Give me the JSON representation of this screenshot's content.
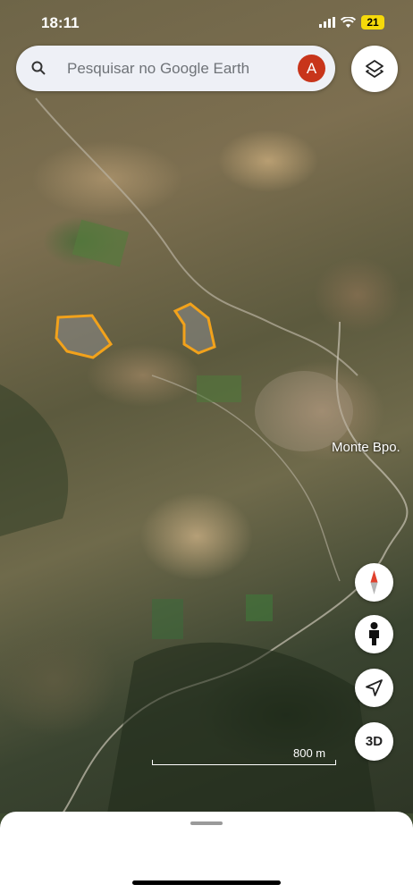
{
  "status_bar": {
    "time": "18:11",
    "battery": "21"
  },
  "search": {
    "placeholder": "Pesquisar no Google Earth"
  },
  "account": {
    "initial": "A",
    "color": "#c8351b"
  },
  "map": {
    "place_label": "Monte Bpo.",
    "scale_label": "800 m",
    "highlight_color": "#f2a21b"
  },
  "controls": {
    "three_d_label": "3D"
  }
}
